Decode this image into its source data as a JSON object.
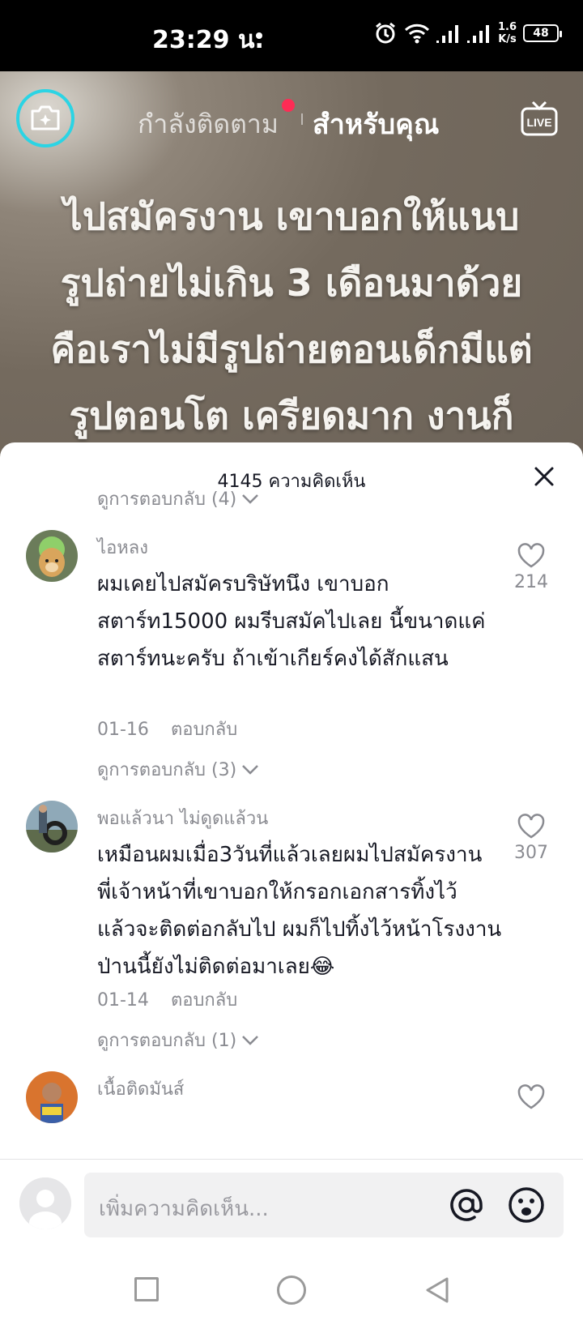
{
  "status_bar": {
    "time": "23:29 น.",
    "net_speed_value": "1.6",
    "net_speed_unit": "K/s",
    "battery": "48"
  },
  "video": {
    "tabs": {
      "following": "กำลังติดตาม",
      "for_you": "สำหรับคุณ"
    },
    "live_label": "LIVE",
    "overlay_lines": [
      "ไปสมัครงาน เขาบอกให้แนบ",
      "รูปถ่ายไม่เกิน 3 เดือนมาด้วย",
      "คือเราไม่มีรูปถ่ายตอนเด็กมีแต่",
      "รูปตอนโต เครียดมาก งานก็"
    ]
  },
  "comments_sheet": {
    "title": "4145 ความคิดเห็น",
    "view_replies_top": "ดูการตอบกลับ (4)",
    "comments": [
      {
        "username": "ไอหลง",
        "text": "ผมเคยไปสมัครบริษัทนึง เขาบอกสตาร์ท15000 ผมรีบสมัคไปเลย นี้ขนาดแค่สตาร์ทนะครับ ถ้าเข้าเกียร์คงได้สักแสน",
        "date": "01-16",
        "reply_label": "ตอบกลับ",
        "likes": "214",
        "view_replies": "ดูการตอบกลับ (3)"
      },
      {
        "username": "พอแล้วนา ไม่ดูดแล้วน",
        "text": "เหมือนผมเมื่อ3วันที่แล้วเลยผมไปสมัครงาน พี่เจ้าหน้าที่เขาบอกให้กรอกเอกสารทิ้งไว้ แล้วจะติดต่อกลับไป ผมก็ไปทิ้งไว้หน้าโรงงาน ป่านนี้ยังไม่ติดต่อมาเลย😂",
        "date": "01-14",
        "reply_label": "ตอบกลับ",
        "likes": "307",
        "view_replies": "ดูการตอบกลับ (1)"
      },
      {
        "username": "เนื้อติดมันส์"
      }
    ]
  },
  "input_bar": {
    "placeholder": "เพิ่มความคิดเห็น..."
  }
}
